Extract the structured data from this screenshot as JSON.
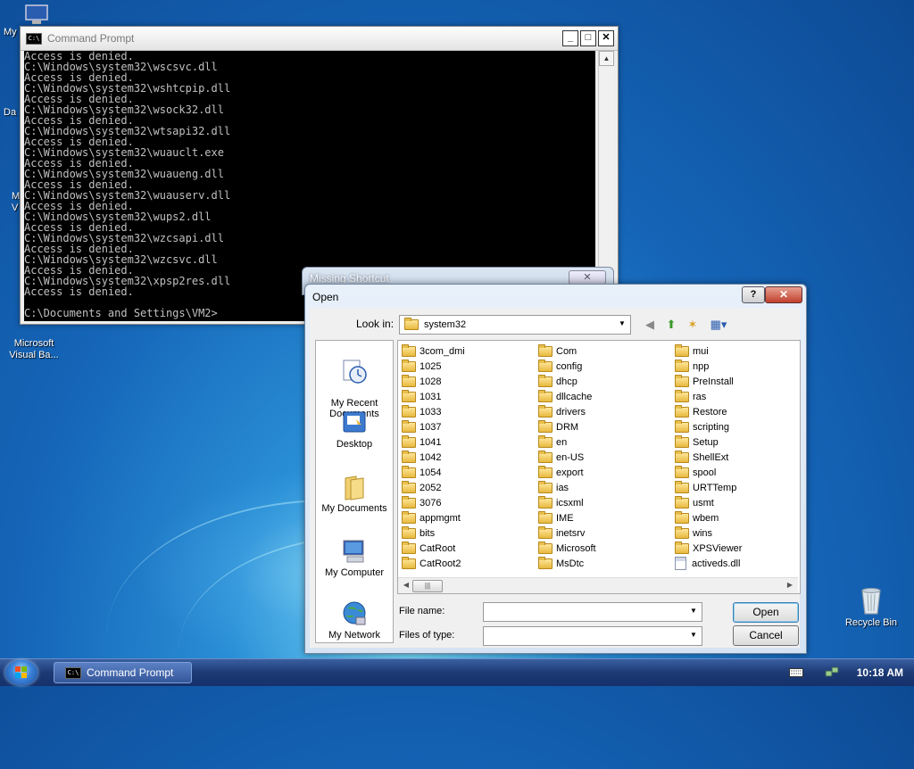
{
  "desktop": {
    "icons": [
      {
        "name": "my-computer",
        "label": "My"
      },
      {
        "name": "data",
        "label": "Da"
      },
      {
        "name": "media",
        "label": "M\nV"
      },
      {
        "name": "visual-basic",
        "label": "Microsoft\nVisual Ba..."
      },
      {
        "name": "recycle-bin",
        "label": "Recycle Bin"
      }
    ]
  },
  "cmd": {
    "title": "Command Prompt",
    "lines": [
      "Access is denied.",
      "C:\\Windows\\system32\\wscsvc.dll",
      "Access is denied.",
      "C:\\Windows\\system32\\wshtcpip.dll",
      "Access is denied.",
      "C:\\Windows\\system32\\wsock32.dll",
      "Access is denied.",
      "C:\\Windows\\system32\\wtsapi32.dll",
      "Access is denied.",
      "C:\\Windows\\system32\\wuauclt.exe",
      "Access is denied.",
      "C:\\Windows\\system32\\wuaueng.dll",
      "Access is denied.",
      "C:\\Windows\\system32\\wuauserv.dll",
      "Access is denied.",
      "C:\\Windows\\system32\\wups2.dll",
      "Access is denied.",
      "C:\\Windows\\system32\\wzcsapi.dll",
      "Access is denied.",
      "C:\\Windows\\system32\\wzcsvc.dll",
      "Access is denied.",
      "C:\\Windows\\system32\\xpsp2res.dll",
      "Access is denied.",
      "",
      "C:\\Documents and Settings\\VM2>"
    ]
  },
  "missing_shortcut": {
    "title": "Missing Shortcut"
  },
  "open_dialog": {
    "title": "Open",
    "look_in_label": "Look in:",
    "look_in_value": "system32",
    "places": [
      "My Recent\nDocuments",
      "Desktop",
      "My Documents",
      "My Computer",
      "My Network"
    ],
    "columns": [
      [
        "3com_dmi",
        "1025",
        "1028",
        "1031",
        "1033",
        "1037",
        "1041",
        "1042",
        "1054",
        "2052",
        "3076",
        "appmgmt",
        "bits",
        "CatRoot",
        "CatRoot2"
      ],
      [
        "Com",
        "config",
        "dhcp",
        "dllcache",
        "drivers",
        "DRM",
        "en",
        "en-US",
        "export",
        "ias",
        "icsxml",
        "IME",
        "inetsrv",
        "Microsoft",
        "MsDtc"
      ],
      [
        "mui",
        "npp",
        "PreInstall",
        "ras",
        "Restore",
        "scripting",
        "Setup",
        "ShellExt",
        "spool",
        "URTTemp",
        "usmt",
        "wbem",
        "wins",
        "XPSViewer",
        "activeds.dll"
      ]
    ],
    "file_name_label": "File name:",
    "file_name_value": "",
    "files_of_type_label": "Files of type:",
    "files_of_type_value": "",
    "open_button": "Open",
    "cancel_button": "Cancel",
    "help_glyph": "?",
    "close_glyph": "✕"
  },
  "taskbar": {
    "task_label": "Command Prompt",
    "clock": "10:18 AM"
  },
  "colors": {
    "console_bg": "#000000",
    "console_fg": "#c0c0c0",
    "desktop_blue": "#1565b8",
    "folder_yellow": "#e7b93e"
  }
}
